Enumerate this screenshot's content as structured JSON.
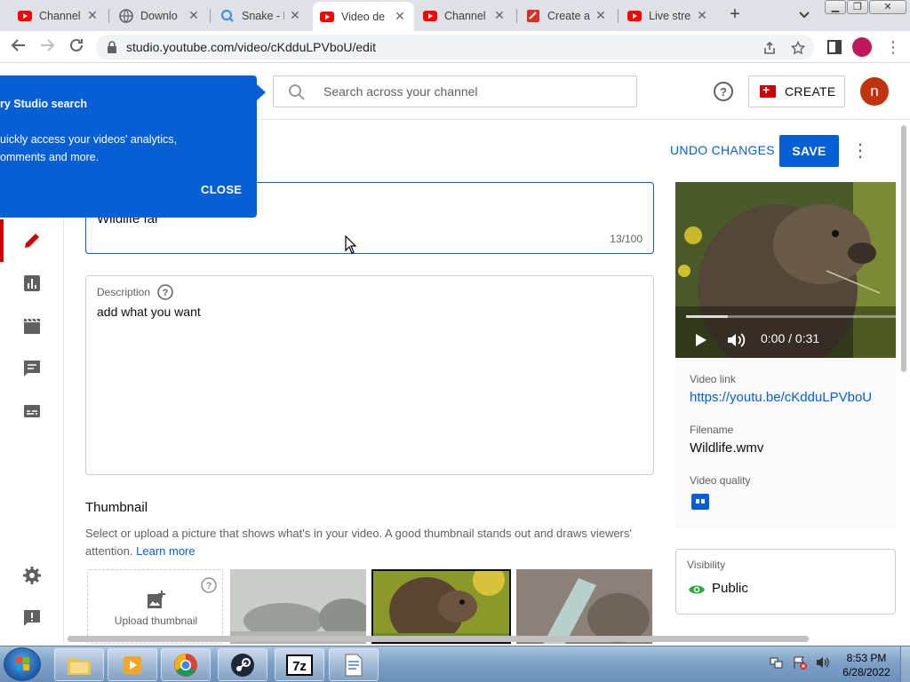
{
  "browser": {
    "tabs": [
      {
        "title": "Channel",
        "icon": "youtube-icon",
        "active": false
      },
      {
        "title": "Downlo",
        "icon": "globe-icon",
        "active": false
      },
      {
        "title": "Snake - P",
        "icon": "snake-game-icon",
        "active": false
      },
      {
        "title": "Video de",
        "icon": "youtube-icon",
        "active": true
      },
      {
        "title": "Channel",
        "icon": "youtube-icon",
        "active": false
      },
      {
        "title": "Create an",
        "icon": "create-icon",
        "active": false
      },
      {
        "title": "Live strea",
        "icon": "youtube-icon",
        "active": false
      }
    ],
    "url": "studio.youtube.com/video/cKdduLPVboU/edit"
  },
  "header": {
    "search_placeholder": "Search across your channel",
    "create_label": "CREATE",
    "avatar_letter": "n"
  },
  "tooltip": {
    "heading": "ry Studio search",
    "body_line1": "uickly access your videos' analytics,",
    "body_line2": "omments and more.",
    "close_label": "CLOSE"
  },
  "editor": {
    "undo_label": "UNDO CHANGES",
    "save_label": "SAVE",
    "title_value": "Wildlife far",
    "title_count": "13/100",
    "description_label": "Description",
    "description_value": "add what you want",
    "thumbnail_heading": "Thumbnail",
    "thumbnail_desc": "Select or upload a picture that shows what's in your video. A good thumbnail stands out and draws viewers' attention.",
    "learn_more": "Learn more",
    "upload_label": "Upload thumbnail"
  },
  "sidebar_panel": {
    "video_time": "0:00 / 0:31",
    "video_progress": 0.2,
    "video_link_label": "Video link",
    "video_link": "https://youtu.be/cKdduLPVboU",
    "filename_label": "Filename",
    "filename": "Wildlife.wmv",
    "quality_label": "Video quality",
    "visibility_label": "Visibility",
    "visibility_value": "Public"
  },
  "taskbar": {
    "time": "8:53 PM",
    "date": "6/28/2022"
  },
  "colors": {
    "accent": "#065fd4",
    "brand_red": "#cc0000",
    "visibility_green": "#2ba640"
  }
}
